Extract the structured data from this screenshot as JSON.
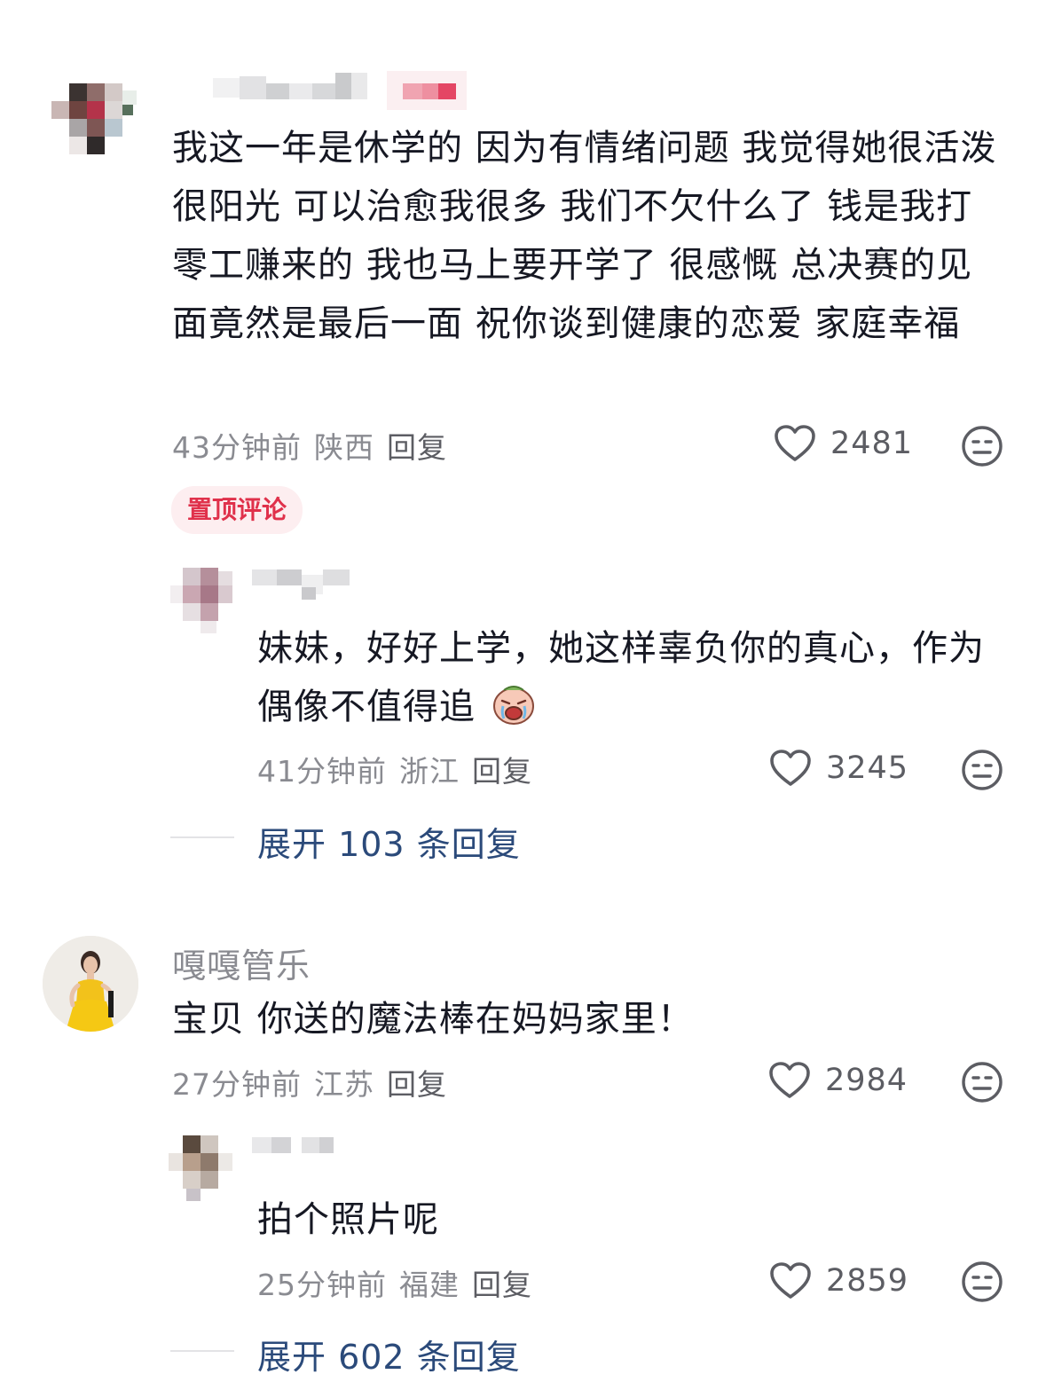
{
  "comments": [
    {
      "text": "我这一年是休学的 因为有情绪问题 我觉得她很活泼很阳光 可以治愈我很多 我们不欠什么了 钱是我打零工赚来的 我也马上要开学了 很感慨 总决赛的见面竟然是最后一面 祝你谈到健康的恋爱 家庭幸福",
      "time": "43分钟前",
      "location": "陕西",
      "reply_label": "回复",
      "likes": "2481",
      "pin_badge": "置顶评论",
      "sub_reply": {
        "text": "妹妹，好好上学，她这样辜负你的真心，作为偶像不值得追",
        "time": "41分钟前",
        "location": "浙江",
        "reply_label": "回复",
        "likes": "3245"
      },
      "expand_label": "展开 103 条回复"
    },
    {
      "username": "嘎嘎管乐",
      "text": "宝贝 你送的魔法棒在妈妈家里！",
      "time": "27分钟前",
      "location": "江苏",
      "reply_label": "回复",
      "likes": "2984",
      "sub_reply": {
        "text": "拍个照片呢",
        "time": "25分钟前",
        "location": "福建",
        "reply_label": "回复",
        "likes": "2859"
      },
      "expand_label": "展开 602 条回复"
    }
  ],
  "icons": {
    "like": "heart-outline-icon",
    "dislike": "neutral-face-icon",
    "emoji": "crying-face-emoji"
  },
  "colors": {
    "pin_badge_text": "#e0314b",
    "pin_badge_bg": "#fdeef0",
    "expand_link": "#2b4a7a",
    "meta_text": "#8a8b91"
  }
}
